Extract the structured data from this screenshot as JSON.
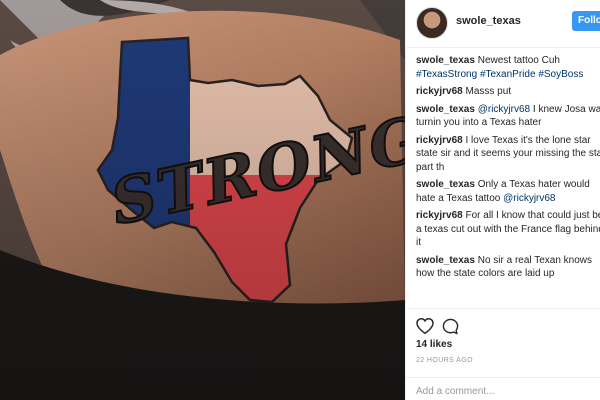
{
  "post": {
    "username": "swole_texas",
    "follow_label": "Follow",
    "photo_text": "STRONG"
  },
  "comments": [
    {
      "user": "swole_texas",
      "line1": "Newest tattoo Cuh ",
      "hashtag1": "#TexasStrong",
      "hashtag2": "#TexanPride",
      "hashtag3": "#SoyBoss"
    },
    {
      "user": "rickyjrv68",
      "text": "Masss put"
    },
    {
      "user": "swole_texas",
      "mention": "@rickyjrv68",
      "text": " I knew Josa was turnin you into a Texas hater"
    },
    {
      "user": "rickyjrv68",
      "text": "I love Texas it's the lone star state sir and it seems your missing the star part th"
    },
    {
      "user": "swole_texas",
      "text": "Only a Texas hater would hate a Texas tattoo ",
      "mention": "@rickyjrv68"
    },
    {
      "user": "rickyjrv68",
      "text": "For all I know that could just be a texas cut out with the France flag behind it"
    },
    {
      "user": "swole_texas",
      "text": "No sir a real Texan knows how the state colors are laid up"
    }
  ],
  "footer": {
    "likes": "14 likes",
    "time": "22 HOURS AGO",
    "add_comment_placeholder": "Add a comment..."
  },
  "colors": {
    "follow_button": "#3897f0",
    "link": "#003569",
    "flag_blue": "#1f3a78",
    "flag_red": "#e0474c",
    "skin": "#b07a5e"
  }
}
